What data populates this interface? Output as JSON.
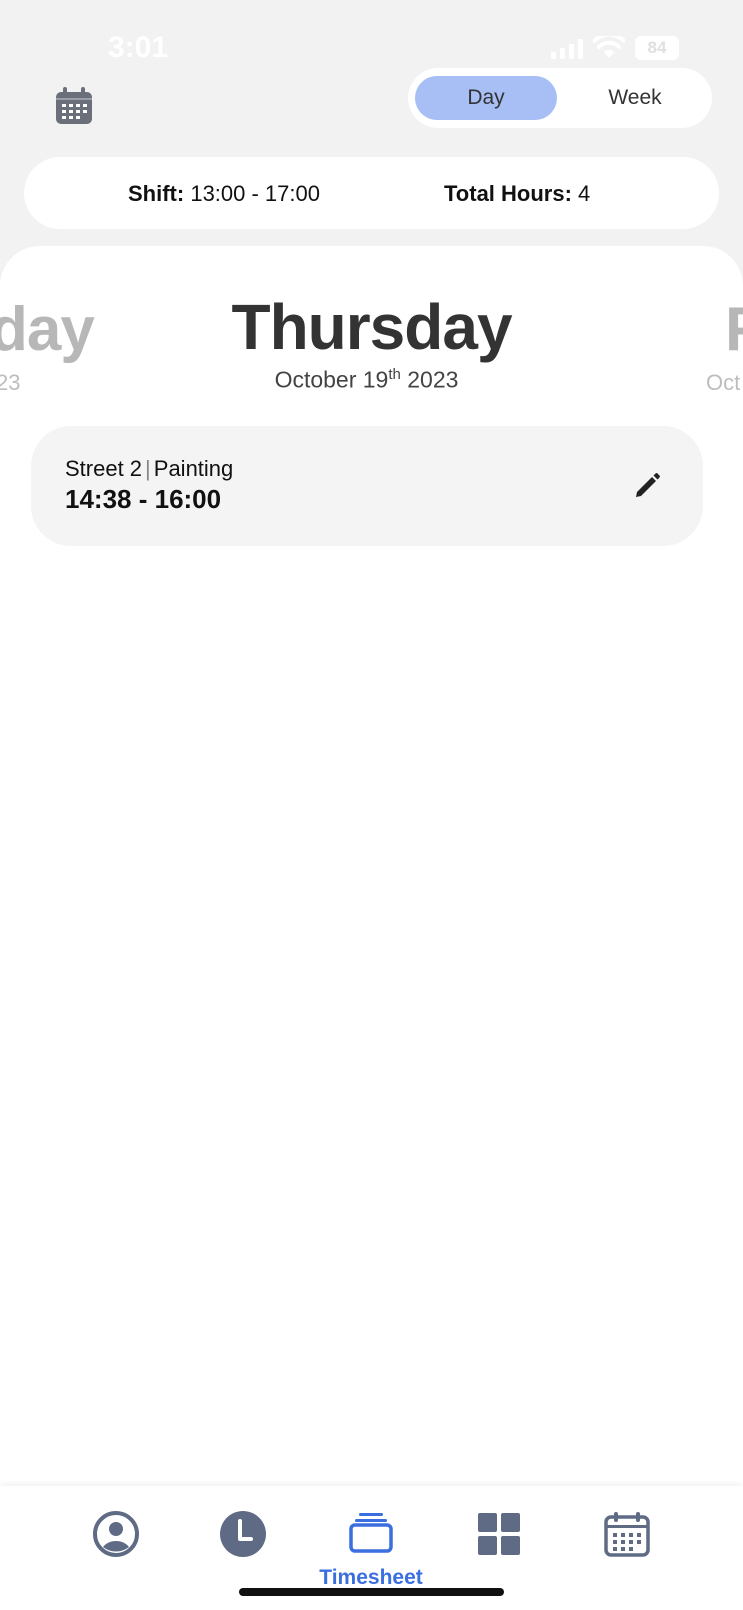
{
  "status_bar": {
    "time": "3:01",
    "battery": "84"
  },
  "header": {
    "view_toggle": {
      "day_label": "Day",
      "week_label": "Week",
      "selected": "Day"
    }
  },
  "summary": {
    "shift_label": "Shift:",
    "shift_value": "13:00 - 17:00",
    "total_label": "Total Hours:",
    "total_value": "4"
  },
  "day_carousel": {
    "previous": {
      "day_fragment": "day",
      "date_fragment": "23"
    },
    "current": {
      "day": "Thursday",
      "month_day": "October 19",
      "ordinal": "th",
      "year": "2023"
    },
    "next": {
      "day_fragment": "F",
      "date_fragment": "Oct"
    }
  },
  "entries": [
    {
      "location": "Street 2",
      "separator": "|",
      "task": "Painting",
      "time_range": "14:38 - 16:00"
    }
  ],
  "bottom_nav": {
    "active_label": "Timesheet",
    "items": [
      "profile-icon",
      "clock-icon",
      "timesheet-icon",
      "dashboard-icon",
      "calendar-icon"
    ],
    "active_color": "#3b6fe0",
    "inactive_color": "#5f6b85"
  },
  "colors": {
    "toggle_active": "#a7bff5",
    "background": "#f2f2f2"
  }
}
